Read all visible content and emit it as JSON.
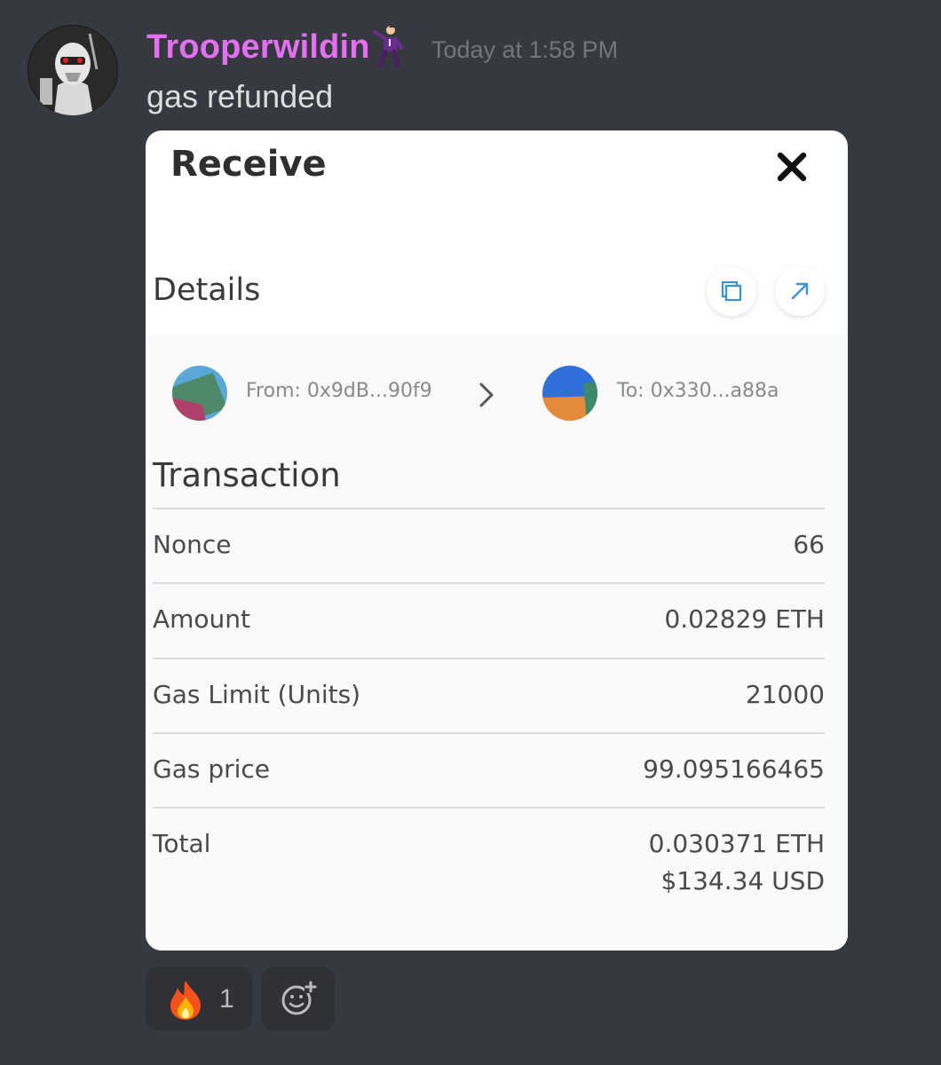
{
  "message": {
    "username": "Trooperwildin",
    "username_emoji": "man-dancing-emoji",
    "timestamp": "Today at 1:58 PM",
    "text": "gas refunded",
    "username_color": "#e56ff2"
  },
  "card": {
    "title": "Receive",
    "details_title": "Details",
    "from_label": "From: 0x9dB...90f9",
    "to_label": "To: 0x330...a88a",
    "section_title": "Transaction",
    "rows": [
      {
        "label": "Nonce",
        "value": "66"
      },
      {
        "label": "Amount",
        "value": "0.02829 ETH"
      },
      {
        "label": "Gas Limit (Units)",
        "value": "21000"
      },
      {
        "label": "Gas price",
        "value": "99.095166465"
      },
      {
        "label": "Total",
        "value": "0.030371 ETH",
        "value2": "$134.34 USD"
      }
    ],
    "accent_color": "#3d8fe0"
  },
  "reactions": [
    {
      "emoji": "fire-emoji",
      "count": "1"
    }
  ],
  "icons": [
    "close-icon",
    "copy-icon",
    "external-link-icon",
    "chevron-right-icon",
    "add-reaction-icon"
  ]
}
